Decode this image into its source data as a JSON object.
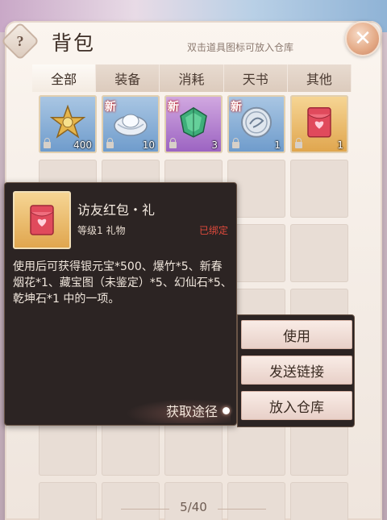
{
  "header": {
    "help_label": "?",
    "title": "背包",
    "hint": "双击道具图标可放入仓库",
    "close_label": "✕"
  },
  "tabs": [
    {
      "label": "全部",
      "active": true
    },
    {
      "label": "装备",
      "active": false
    },
    {
      "label": "消耗",
      "active": false
    },
    {
      "label": "天书",
      "active": false
    },
    {
      "label": "其他",
      "active": false
    }
  ],
  "items": [
    {
      "icon": "gold-star-medal-icon",
      "rarity": "blue",
      "new": "",
      "count": "400"
    },
    {
      "icon": "silver-ingot-icon",
      "rarity": "blue",
      "new": "新",
      "count": "10"
    },
    {
      "icon": "green-gem-icon",
      "rarity": "purple",
      "new": "新",
      "count": "3"
    },
    {
      "icon": "silver-coin-icon",
      "rarity": "blue",
      "new": "新",
      "count": "1"
    },
    {
      "icon": "red-envelope-icon",
      "rarity": "gold",
      "new": "",
      "count": "1"
    }
  ],
  "tooltip": {
    "name": "访友红包・礼",
    "meta": "等级1 礼物",
    "bound": "已绑定",
    "description": "使用后可获得银元宝*500、爆竹*5、新春烟花*1、藏宝图（未鉴定）*5、幻仙石*5、乾坤石*1 中的一项。",
    "obtain_label": "获取途径"
  },
  "actions": {
    "use": "使用",
    "send_link": "发送链接",
    "store": "放入仓库"
  },
  "pager": {
    "text": "5/40"
  },
  "colors": {
    "bound_red": "#e04a3c",
    "tooltip_bg": "#2c2423",
    "panel_bg": "#f3ebe4"
  }
}
